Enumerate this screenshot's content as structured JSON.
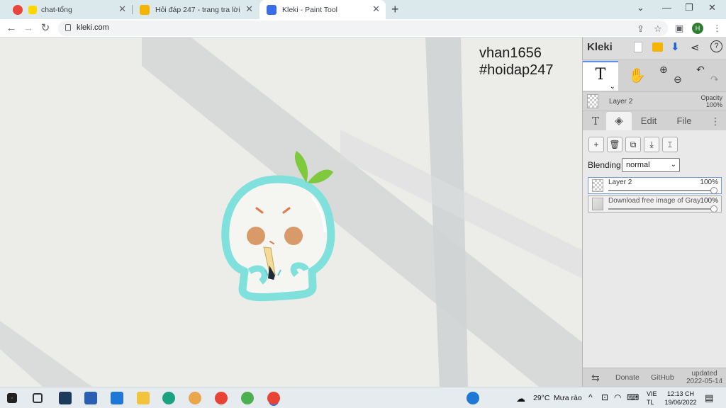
{
  "browser": {
    "tabs": [
      {
        "title": "chat-tổng",
        "active": false
      },
      {
        "title": "Hỏi đáp 247 - trang tra lời",
        "active": false
      },
      {
        "title": "Kleki - Paint Tool",
        "active": true
      }
    ],
    "new_tab_label": "+",
    "url": "kleki.com",
    "profile_initial": "H"
  },
  "canvas": {
    "watermark_line1": "vhan1656",
    "watermark_line2": "#hoidap247"
  },
  "kleki": {
    "logo": "Kleki",
    "tool_text_glyph": "T",
    "layer_header": {
      "name": "Layer 2",
      "opacity_label": "Opacity",
      "opacity_value": "100%"
    },
    "tabs": [
      {
        "label": "T"
      },
      {
        "label": "Layers"
      },
      {
        "label": "Edit"
      },
      {
        "label": "File"
      }
    ],
    "layer_buttons": [
      "+",
      "delete",
      "duplicate",
      "merge",
      "rename"
    ],
    "blending_label": "Blending",
    "blending_value": "normal",
    "layers": [
      {
        "name": "Layer 2",
        "opacity": "100%",
        "active": true
      },
      {
        "name": "Download free image of Gray",
        "opacity": "100%",
        "active": false
      }
    ],
    "footer": {
      "donate": "Donate",
      "github": "GitHub",
      "updated_label": "updated",
      "updated_date": "2022-05-14"
    }
  },
  "taskbar": {
    "weather_temp": "29°C",
    "weather_desc": "Mưa rào",
    "lang_top": "VIE",
    "lang_bottom": "TL",
    "time": "12:13 CH",
    "date": "19/06/2022"
  },
  "colors": {
    "tab_strip": "#dbe9ec",
    "canvas_bg": "#ecece8",
    "drawing_outline": "#7fe0dc",
    "leaf_green": "#7ec93c",
    "cheek": "#d99a6a",
    "panel_bg": "#d2d2d2"
  }
}
